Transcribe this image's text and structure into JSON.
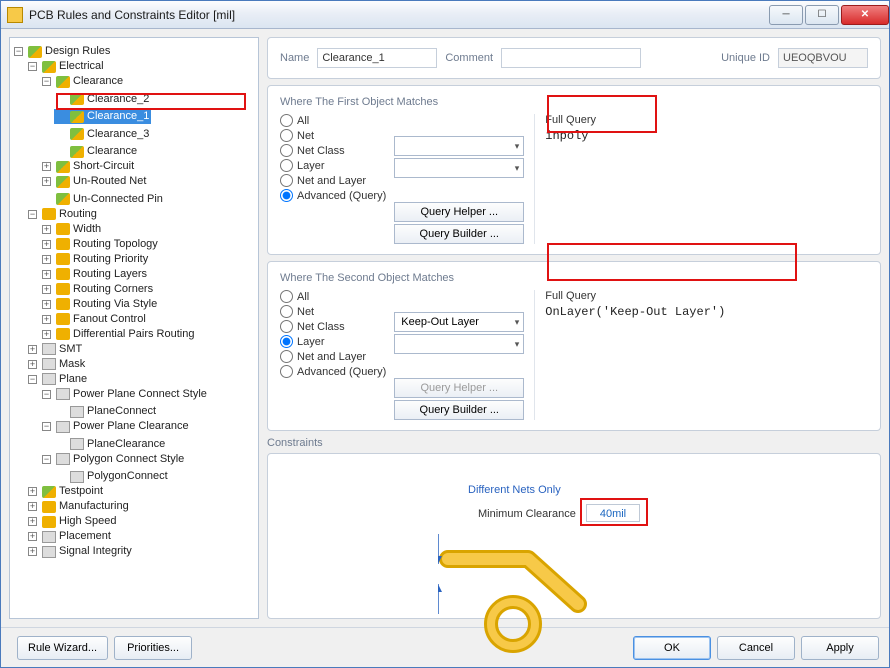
{
  "window": {
    "title": "PCB Rules and Constraints Editor [mil]"
  },
  "tree": {
    "root": "Design Rules",
    "electrical": "Electrical",
    "clearance": "Clearance",
    "clearance2": "Clearance_2",
    "clearance1": "Clearance_1",
    "clearance3": "Clearance_3",
    "clearance_base": "Clearance",
    "shortcircuit": "Short-Circuit",
    "unrouted": "Un-Routed Net",
    "unconnected": "Un-Connected Pin",
    "routing": "Routing",
    "width": "Width",
    "topology": "Routing Topology",
    "priority": "Routing Priority",
    "layers": "Routing Layers",
    "corners": "Routing Corners",
    "viastyle": "Routing Via Style",
    "fanout": "Fanout Control",
    "diffpairs": "Differential Pairs Routing",
    "smt": "SMT",
    "mask": "Mask",
    "plane": "Plane",
    "ppconnect": "Power Plane Connect Style",
    "planeconnect": "PlaneConnect",
    "ppclearance": "Power Plane Clearance",
    "planeclearance": "PlaneClearance",
    "polyconnect_style": "Polygon Connect Style",
    "polyconnect": "PolygonConnect",
    "testpoint": "Testpoint",
    "manufacturing": "Manufacturing",
    "highspeed": "High Speed",
    "placement": "Placement",
    "sigint": "Signal Integrity"
  },
  "fields": {
    "name_lbl": "Name",
    "name_val": "Clearance_1",
    "comment_lbl": "Comment",
    "comment_val": "",
    "uid_lbl": "Unique ID",
    "uid_val": "UEOQBVOU"
  },
  "match1": {
    "title": "Where The First Object Matches",
    "all": "All",
    "net": "Net",
    "netclass": "Net Class",
    "layer": "Layer",
    "netlayer": "Net and Layer",
    "adv": "Advanced (Query)",
    "fq_title": "Full Query",
    "fq_text": "inpoly",
    "qhelper": "Query Helper ...",
    "qbuilder": "Query Builder ..."
  },
  "match2": {
    "title": "Where The Second Object Matches",
    "all": "All",
    "net": "Net",
    "netclass": "Net Class",
    "layer": "Layer",
    "netlayer": "Net and Layer",
    "adv": "Advanced (Query)",
    "combo": "Keep-Out Layer",
    "fq_title": "Full Query",
    "fq_text": "OnLayer('Keep-Out Layer')",
    "qhelper": "Query Helper ...",
    "qbuilder": "Query Builder ..."
  },
  "constraints": {
    "title": "Constraints",
    "diffnets": "Different Nets Only",
    "minc_lbl": "Minimum Clearance",
    "minc_val": "40mil"
  },
  "footer": {
    "rulewiz": "Rule Wizard...",
    "priorities": "Priorities...",
    "ok": "OK",
    "cancel": "Cancel",
    "apply": "Apply"
  }
}
